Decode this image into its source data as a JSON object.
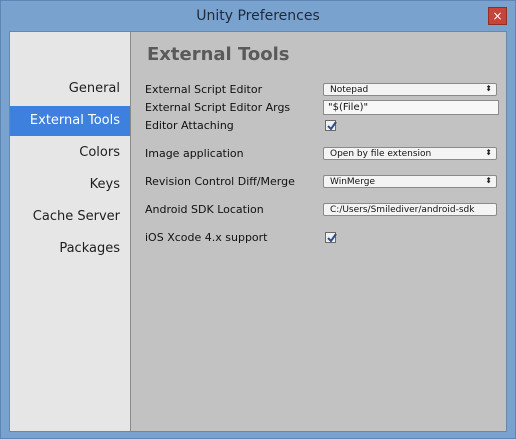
{
  "window": {
    "title": "Unity Preferences",
    "close_label": "×"
  },
  "sidebar": {
    "items": [
      {
        "label": "General",
        "active": false
      },
      {
        "label": "External Tools",
        "active": true
      },
      {
        "label": "Colors",
        "active": false
      },
      {
        "label": "Keys",
        "active": false
      },
      {
        "label": "Cache Server",
        "active": false
      },
      {
        "label": "Packages",
        "active": false
      }
    ]
  },
  "main": {
    "heading": "External Tools",
    "script_editor": {
      "label": "External Script Editor",
      "value": "Notepad"
    },
    "script_editor_args": {
      "label": "External Script Editor Args",
      "value": "\"$(File)\""
    },
    "editor_attaching": {
      "label": "Editor Attaching",
      "checked": true
    },
    "image_application": {
      "label": "Image application",
      "value": "Open by file extension"
    },
    "diff_merge": {
      "label": "Revision Control Diff/Merge",
      "value": "WinMerge"
    },
    "android_sdk": {
      "label": "Android SDK Location",
      "value": "C:/Users/Smilediver/android-sdk"
    },
    "ios_xcode": {
      "label": "iOS Xcode 4.x support",
      "checked": true
    }
  },
  "colors": {
    "accent": "#3d80dd"
  }
}
